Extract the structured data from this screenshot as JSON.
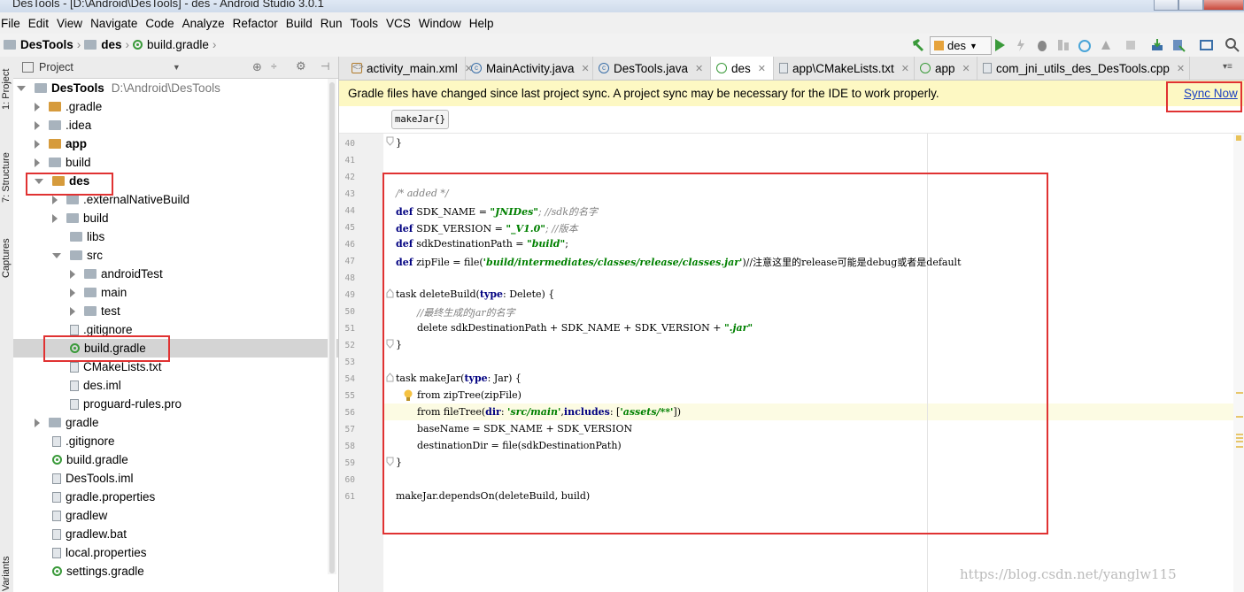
{
  "window": {
    "title": "DesTools - [D:\\Android\\DesTools] - des - Android Studio 3.0.1"
  },
  "menu": [
    "File",
    "Edit",
    "View",
    "Navigate",
    "Code",
    "Analyze",
    "Refactor",
    "Build",
    "Run",
    "Tools",
    "VCS",
    "Window",
    "Help"
  ],
  "breadcrumb": {
    "root": "DesTools",
    "module": "des",
    "file": "build.gradle"
  },
  "toolbar": {
    "run_config": "des"
  },
  "sidebar_tabs": {
    "project": "1: Project",
    "structure": "7: Structure",
    "captures": "Captures",
    "variants": "Variants"
  },
  "project": {
    "header": "Project",
    "items": [
      {
        "label": "DesTools",
        "path": "D:\\Android\\DesTools"
      },
      {
        "label": ".gradle"
      },
      {
        "label": ".idea"
      },
      {
        "label": "app"
      },
      {
        "label": "build"
      },
      {
        "label": "des"
      },
      {
        "label": ".externalNativeBuild"
      },
      {
        "label": "build"
      },
      {
        "label": "libs"
      },
      {
        "label": "src"
      },
      {
        "label": "androidTest"
      },
      {
        "label": "main"
      },
      {
        "label": "test"
      },
      {
        "label": ".gitignore"
      },
      {
        "label": "build.gradle"
      },
      {
        "label": "CMakeLists.txt"
      },
      {
        "label": "des.iml"
      },
      {
        "label": "proguard-rules.pro"
      },
      {
        "label": "gradle"
      },
      {
        "label": ".gitignore"
      },
      {
        "label": "build.gradle"
      },
      {
        "label": "DesTools.iml"
      },
      {
        "label": "gradle.properties"
      },
      {
        "label": "gradlew"
      },
      {
        "label": "gradlew.bat"
      },
      {
        "label": "local.properties"
      },
      {
        "label": "settings.gradle"
      }
    ]
  },
  "tabs": [
    "activity_main.xml",
    "MainActivity.java",
    "DesTools.java",
    "des",
    "app\\CMakeLists.txt",
    "app",
    "com_jni_utils_des_DesTools.cpp"
  ],
  "banner": {
    "message": "Gradle files have changed since last project sync. A project sync may be necessary for the IDE to work properly.",
    "action": "Sync Now"
  },
  "editor": {
    "context_chip": "makeJar{}",
    "line_numbers": [
      "40",
      "41",
      "42",
      "43",
      "44",
      "45",
      "46",
      "47",
      "48",
      "49",
      "50",
      "51",
      "52",
      "53",
      "54",
      "55",
      "56",
      "57",
      "58",
      "59",
      "60",
      "61"
    ],
    "lines": {
      "l40": "}",
      "l43": "/* added */",
      "l44a": "def ",
      "l44b": "SDK_NAME = ",
      "l44c": "\"JNIDes\"",
      "l44d": "; //sdk的名字",
      "l45a": "def ",
      "l45b": "SDK_VERSION = ",
      "l45c": "\"_V1.0\"",
      "l45d": "; //版本",
      "l46a": "def ",
      "l46b": "sdkDestinationPath = ",
      "l46c": "\"build\"",
      "l46d": ";",
      "l47a": "def ",
      "l47b": "zipFile = file(",
      "l47c": "'build/intermediates/classes/release/classes.jar'",
      "l47d": ")//注意这里的release可能是debug或者是default",
      "l49a": "task deleteBuild(",
      "l49b": "type",
      "l49c": ": Delete) {",
      "l50": "//最终生成的jar的名字",
      "l51a": "delete sdkDestinationPath + SDK_NAME + SDK_VERSION + ",
      "l51b": "\".jar\"",
      "l52": "}",
      "l54a": "task makeJar(",
      "l54b": "type",
      "l54c": ": Jar) {",
      "l55": "from zipTree(zipFile)",
      "l56a": "from fileTree(",
      "l56b": "dir",
      "l56c": ": ",
      "l56d": "'src/main'",
      "l56e": ",",
      "l56f": "includes",
      "l56g": ": [",
      "l56h": "'assets/**'",
      "l56i": "])",
      "l57": "baseName = SDK_NAME + SDK_VERSION",
      "l58": "destinationDir = file(sdkDestinationPath)",
      "l59": "}",
      "l61": "makeJar.dependsOn(deleteBuild, build)"
    }
  },
  "watermark": "https://blog.csdn.net/yanglw115",
  "colors": {
    "highlight_box": "#e03232",
    "banner_bg": "#fdf8c3",
    "link": "#1b3fc2",
    "keyword": "#000080",
    "string": "#008000"
  }
}
